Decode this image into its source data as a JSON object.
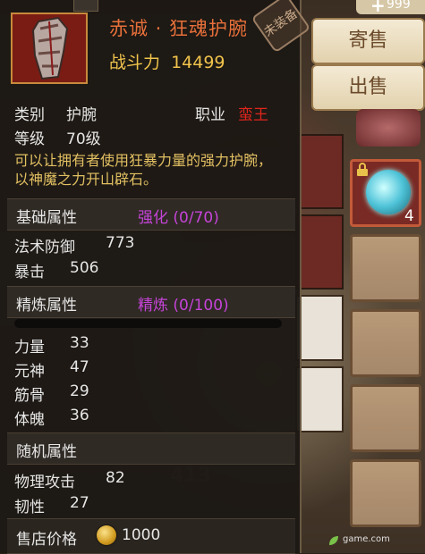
{
  "item": {
    "name": "赤诚 · 狂魂护腕",
    "power_label": "战斗力",
    "power_value": "14499",
    "stamp": "未装备"
  },
  "info": {
    "type_label": "类别",
    "type_value": "护腕",
    "job_label": "职业",
    "job_value": "蛮王",
    "level_label": "等级",
    "level_value": "70级",
    "description": "可以让拥有者使用狂暴力量的强力护腕，以神魔之力开山辟石。"
  },
  "base_section": {
    "title": "基础属性",
    "enhance": "强化 (0/70)",
    "stats": [
      {
        "label": "法术防御",
        "value": "773"
      },
      {
        "label": "暴击",
        "value": "506"
      }
    ]
  },
  "refine_section": {
    "title": "精炼属性",
    "refine": "精炼 (0/100)",
    "progress": 0,
    "stats": [
      {
        "label": "力量",
        "value": "33"
      },
      {
        "label": "元神",
        "value": "47"
      },
      {
        "label": "筋骨",
        "value": "29"
      },
      {
        "label": "体魄",
        "value": "36"
      }
    ]
  },
  "random_section": {
    "title": "随机属性",
    "stats": [
      {
        "label": "物理攻击",
        "value": "82"
      },
      {
        "label": "韧性",
        "value": "27"
      }
    ]
  },
  "price": {
    "label": "售店价格",
    "value": "1000"
  },
  "buttons": {
    "consign": "寄售",
    "sell": "出售"
  },
  "top_badge": {
    "plus": "+",
    "value": "999"
  },
  "inventory": {
    "locked_item_count": "4"
  },
  "background": {
    "scene_number": "413"
  },
  "watermark": "game.com"
}
